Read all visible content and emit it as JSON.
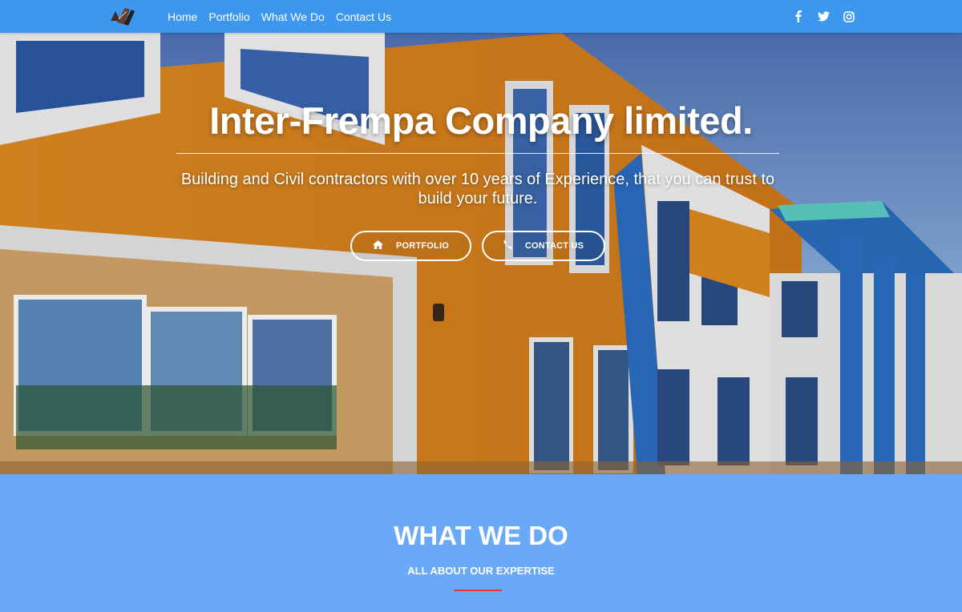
{
  "nav": {
    "logo_icon": "brush-roller-logo",
    "links": [
      {
        "label": "Home"
      },
      {
        "label": "Portfolio"
      },
      {
        "label": "What We Do"
      },
      {
        "label": "Contact Us"
      }
    ],
    "social": [
      "facebook-icon",
      "twitter-icon",
      "instagram-icon"
    ]
  },
  "hero": {
    "title": "Inter-Frempa Company limited.",
    "subtitle": "Building and Civil contractors with over 10 years of Experience, that you can trust to build your future.",
    "buttons": [
      {
        "label": "PORTFOLIO",
        "icon": "home-icon"
      },
      {
        "label": "CONTACT US",
        "icon": "phone-icon"
      }
    ]
  },
  "section": {
    "title": "WHAT WE DO",
    "subtitle": "ALL ABOUT OUR EXPERTISE",
    "accent_color": "#e53935"
  },
  "colors": {
    "navbar": "#3d97ef",
    "section_bg": "#6aa9f8"
  }
}
